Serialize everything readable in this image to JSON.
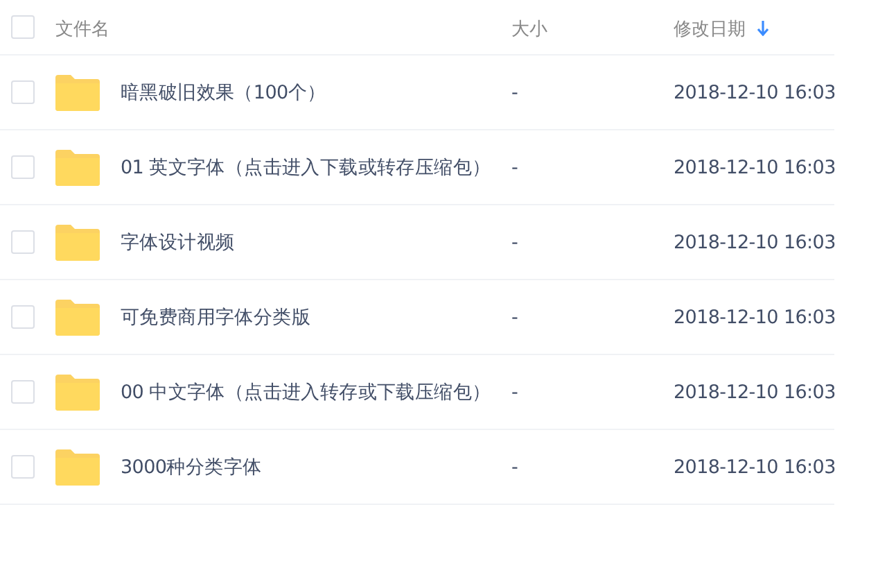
{
  "header": {
    "checked": false,
    "columns": [
      {
        "label": "文件名",
        "sorted": false
      },
      {
        "label": "大小",
        "sorted": false
      },
      {
        "label": "修改日期",
        "sorted": true
      }
    ]
  },
  "rows": [
    {
      "checked": false,
      "name": "暗黑破旧效果（100个）",
      "size": "-",
      "modified": "2018-12-10 16:03"
    },
    {
      "checked": false,
      "name": "01 英文字体（点击进入下载或转存压缩包）",
      "size": "-",
      "modified": "2018-12-10 16:03"
    },
    {
      "checked": false,
      "name": "字体设计视频",
      "size": "-",
      "modified": "2018-12-10 16:03"
    },
    {
      "checked": false,
      "name": "可免费商用字体分类版",
      "size": "-",
      "modified": "2018-12-10 16:03"
    },
    {
      "checked": false,
      "name": "00 中文字体（点击进入转存或下载压缩包）",
      "size": "-",
      "modified": "2018-12-10 16:03"
    },
    {
      "checked": false,
      "name": "3000种分类字体",
      "size": "-",
      "modified": "2018-12-10 16:03"
    }
  ]
}
